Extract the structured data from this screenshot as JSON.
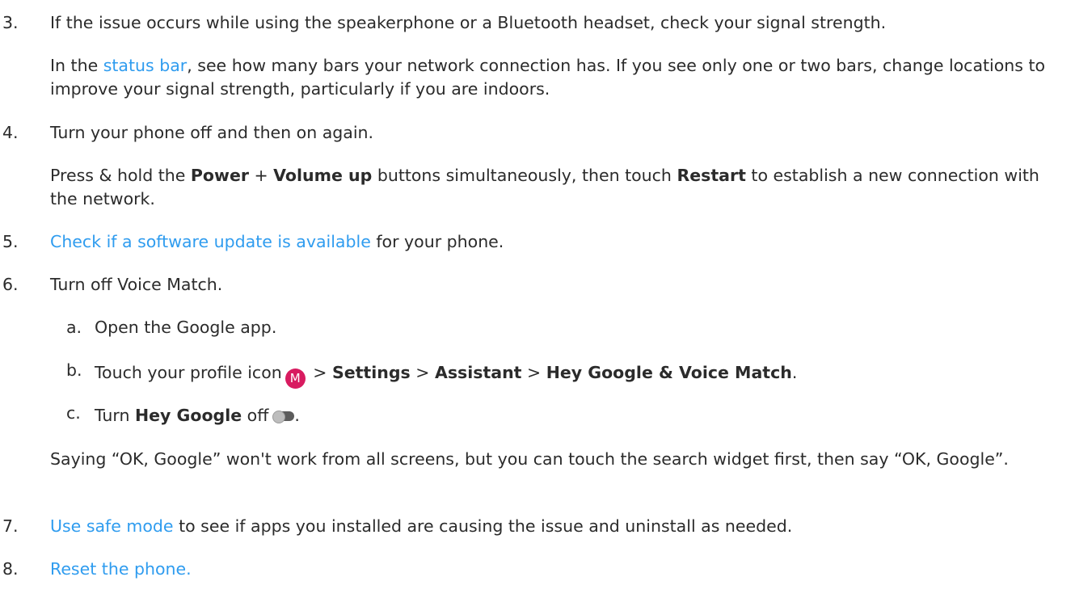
{
  "step3": {
    "num": "3.",
    "text": "If the issue occurs while using the speakerphone or a Bluetooth headset, check your signal strength.",
    "detail_pre": "In the ",
    "detail_link": "status bar",
    "detail_post": ", see how many bars your network connection has. If you see only one or two bars, change locations to improve your signal strength, particularly if you are indoors."
  },
  "step4": {
    "num": "4.",
    "text": "Turn your phone off and then on again.",
    "detail_1": "Press & hold the ",
    "bold_power": "Power",
    "detail_2": " + ",
    "bold_volume": "Volume up",
    "detail_3": " buttons simultaneously, then touch ",
    "bold_restart": "Restart",
    "detail_4": " to establish a new connection with the network."
  },
  "step5": {
    "num": "5.",
    "link": "Check if a software update is available",
    "post": " for your phone."
  },
  "step6": {
    "num": "6.",
    "text": "Turn off Voice Match.",
    "sub_a": {
      "letter": "a.",
      "text": "Open the Google app."
    },
    "sub_b": {
      "letter": "b.",
      "pre": "Touch your profile icon",
      "avatar_letter": "M",
      "sep1": " > ",
      "settings": "Settings",
      "sep2": " > ",
      "assistant": "Assistant",
      "sep3": " > ",
      "hey_voice": "Hey Google & Voice Match",
      "end": "."
    },
    "sub_c": {
      "letter": "c.",
      "pre": "Turn ",
      "bold": "Hey Google",
      "post": " off",
      "toggle_state": "off",
      "end": "."
    },
    "note": "Saying “OK, Google” won't work from all screens, but you can touch the search widget first, then say “OK, Google”."
  },
  "step7": {
    "num": "7.",
    "link": "Use safe mode",
    "post": " to see if apps you installed are causing the issue and uninstall as needed."
  },
  "step8": {
    "num": "8.",
    "link": "Reset the phone."
  },
  "colors": {
    "link": "#2f9cef",
    "text": "#2b2b2b",
    "avatar": "#d81b60"
  },
  "icons": {
    "profile": "profile-avatar-icon",
    "toggle": "toggle-off-icon"
  }
}
